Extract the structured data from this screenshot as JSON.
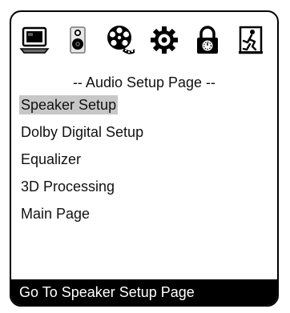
{
  "icons": [
    {
      "name": "monitor-icon",
      "active": false
    },
    {
      "name": "speaker-icon",
      "active": true
    },
    {
      "name": "film-reel-icon",
      "active": false
    },
    {
      "name": "gear-icon",
      "active": false
    },
    {
      "name": "lock-icon",
      "active": false
    },
    {
      "name": "exit-icon",
      "active": false
    }
  ],
  "page_title": "-- Audio Setup Page --",
  "menu": {
    "items": [
      {
        "label": "Speaker Setup",
        "selected": true
      },
      {
        "label": "Dolby Digital Setup",
        "selected": false
      },
      {
        "label": "Equalizer",
        "selected": false
      },
      {
        "label": "3D Processing",
        "selected": false
      },
      {
        "label": "Main Page",
        "selected": false
      }
    ]
  },
  "status": "Go To Speaker Setup Page",
  "colors": {
    "highlight": "#c7c7c7",
    "status_bg": "#000000",
    "status_text": "#ffffff"
  }
}
